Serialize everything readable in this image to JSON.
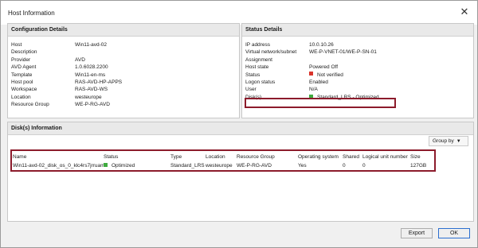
{
  "window": {
    "title": "Host Information"
  },
  "config": {
    "header": "Configuration Details",
    "rows": [
      {
        "label": "Host",
        "value": "Win11-avd-02"
      },
      {
        "label": "Description",
        "value": ""
      },
      {
        "label": "Provider",
        "value": "AVD"
      },
      {
        "label": "AVD Agent",
        "value": "1.0.6028.2200"
      },
      {
        "label": "Template",
        "value": "Win11-en-ms"
      },
      {
        "label": "Host pool",
        "value": "RAS-AVD-HP-APPS"
      },
      {
        "label": "Workspace",
        "value": "RAS-AVD-WS"
      },
      {
        "label": "Location",
        "value": "westeurope"
      },
      {
        "label": "Resource Group",
        "value": "WE-P-RG-AVD"
      }
    ]
  },
  "status": {
    "header": "Status Details",
    "rows": [
      {
        "label": "IP address",
        "value": "10.0.10.26"
      },
      {
        "label": "Virtual network/subnet",
        "value": "WE-P-VNET-01/WE-P-SN-01"
      },
      {
        "label": "Assignment",
        "value": ""
      },
      {
        "label": "Host state",
        "value": "Powered Off"
      },
      {
        "label": "Status",
        "value": "Not verified",
        "indicator": "red",
        "indicator_color": "#d9342b"
      },
      {
        "label": "Logon status",
        "value": "Enabled"
      },
      {
        "label": "User",
        "value": "N/A"
      },
      {
        "label": "Disk(s)",
        "value": "Standard_LRS - Optimized",
        "indicator": "green",
        "indicator_color": "#3fab3f"
      }
    ]
  },
  "disks": {
    "header": "Disk(s) Information",
    "group_by": "Group by",
    "columns": [
      "Name",
      "Status",
      "Type",
      "Location",
      "Resource Group",
      "Operating system",
      "Shared",
      "Logical unit number",
      "Size"
    ],
    "rows": [
      {
        "name": "Win11-avd-02_disk_os_0_klc4rs7jrruam",
        "status": "Optimized",
        "type": "Standard_LRS",
        "location": "westeurope",
        "resource_group": "WE-P-RG-AVD",
        "os": "Yes",
        "shared": "0",
        "lun": "0",
        "size": "127GB"
      }
    ]
  },
  "buttons": {
    "export": "Export",
    "ok": "OK"
  },
  "highlight_color": "#8c1b2b"
}
